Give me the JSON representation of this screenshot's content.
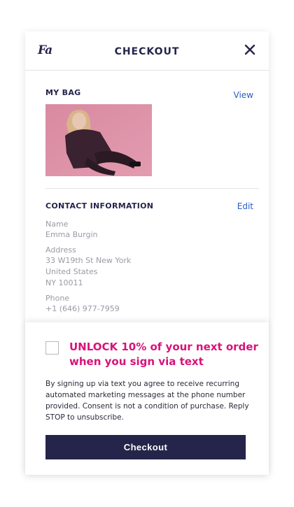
{
  "header": {
    "logo_text": "Fa",
    "title": "CHECKOUT",
    "close_icon": "close-icon"
  },
  "bag": {
    "label": "MY BAG",
    "view_link": "View",
    "item_image": "product-photo"
  },
  "contact": {
    "label": "CONTACT INFORMATION",
    "edit_link": "Edit",
    "name_label": "Name",
    "name_value": "Emma Burgin",
    "address_label": "Address",
    "address_line1": "33 W19th St New York",
    "address_line2": "United States",
    "address_line3": "NY 10011",
    "phone_label": "Phone",
    "phone_value": "+1 (646) 977-7959"
  },
  "promo": {
    "headline": "UNLOCK 10% of your next order when you sign via text",
    "consent": "By signing up via text you agree to receive recurring automated marketing messages at the phone number provided. Consent is not a condition of purchase. Reply STOP to unsubscribe.",
    "checkbox_checked": false
  },
  "actions": {
    "checkout_label": "Checkout"
  },
  "colors": {
    "navy": "#25244a",
    "promo_pink": "#d8137a",
    "link_blue": "#2b5cc2"
  }
}
